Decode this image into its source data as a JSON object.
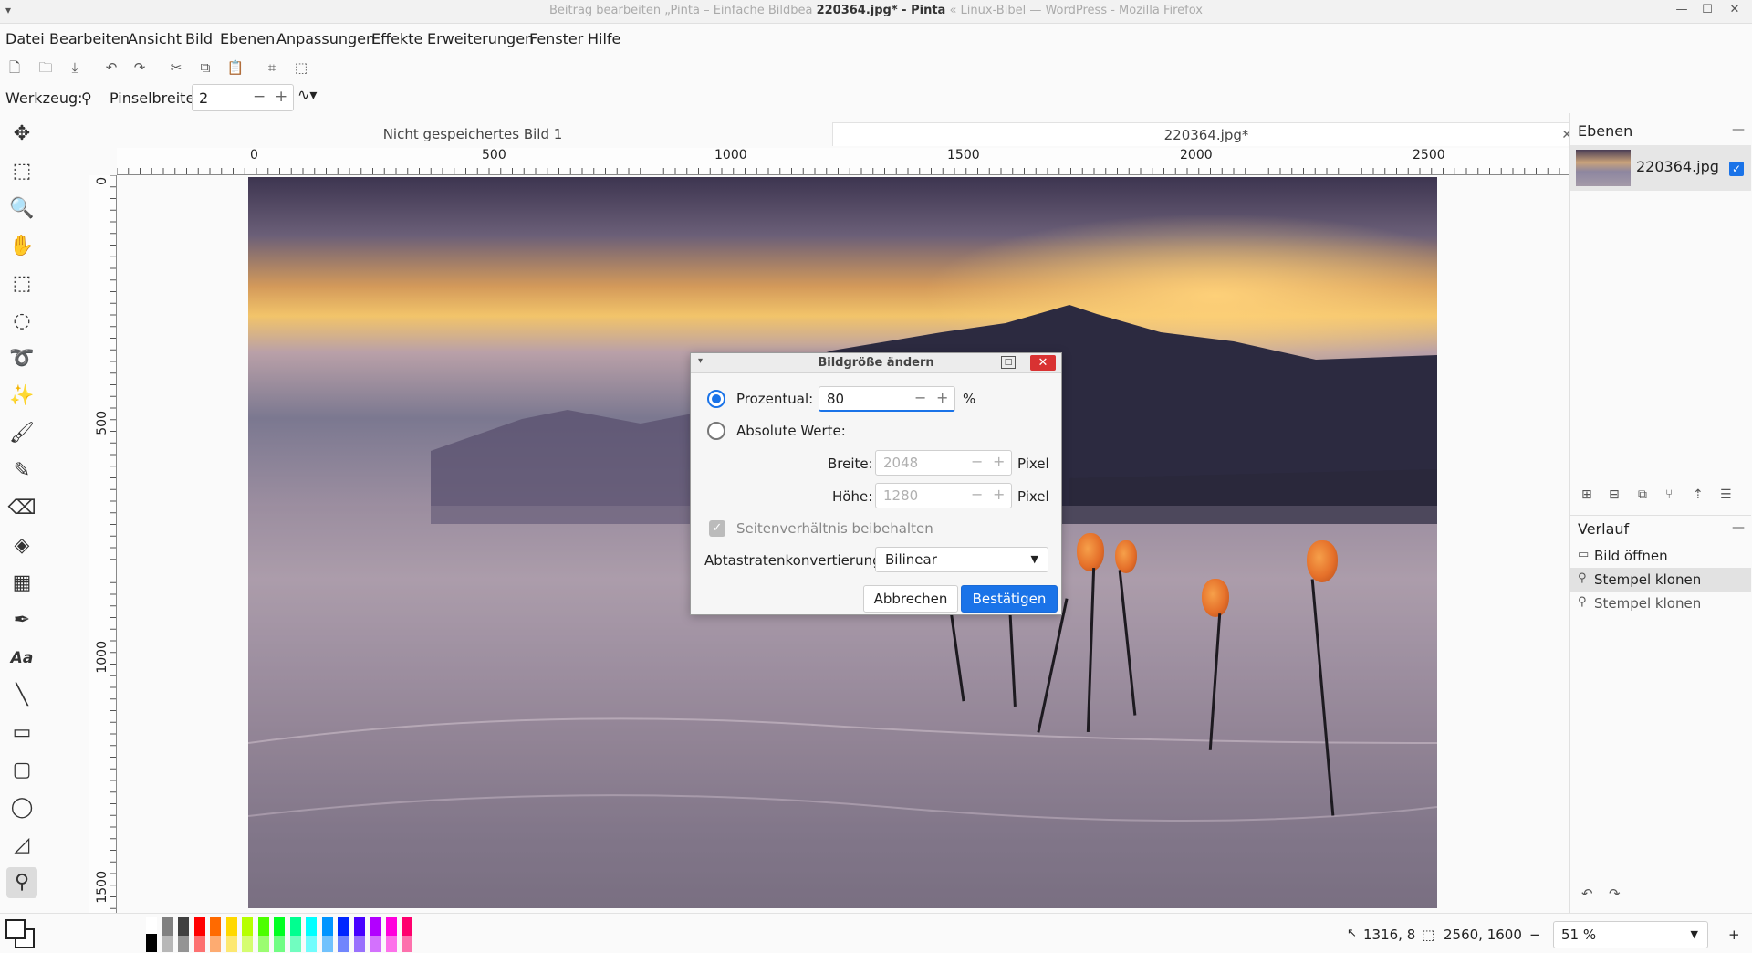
{
  "window": {
    "title_prefix": "Beitrag bearbeiten „Pinta – Einfache Bildbea",
    "title_main": "220364.jpg* - Pinta",
    "title_suffix": "« Linux-Bibel — WordPress - Mozilla Firefox",
    "sys_menu": "▾",
    "minimize": "—",
    "maximize": "☐",
    "close": "✕"
  },
  "menubar": [
    "Datei",
    "Bearbeiten",
    "Ansicht",
    "Bild",
    "Ebenen",
    "Anpassungen",
    "Effekte",
    "Erweiterungen",
    "Fenster",
    "Hilfe"
  ],
  "toolbar_icons": [
    "new-icon",
    "open-icon",
    "save-icon",
    "undo-icon",
    "redo-icon",
    "cut-icon",
    "copy-icon",
    "paste-icon",
    "crop-icon",
    "deselect-icon"
  ],
  "tool_options": {
    "tool_label": "Werkzeug:",
    "brush_label": "Pinselbreite:",
    "brush_value": "2",
    "minus": "−",
    "plus": "+",
    "antialias": "∿▾"
  },
  "tools": [
    {
      "name": "move-selected-tool",
      "glyph": "✥"
    },
    {
      "name": "move-selection-tool",
      "glyph": "⬚"
    },
    {
      "name": "zoom-tool",
      "glyph": "🔍"
    },
    {
      "name": "pan-tool",
      "glyph": "✋"
    },
    {
      "name": "rectangle-select-tool",
      "glyph": "⬚"
    },
    {
      "name": "ellipse-select-tool",
      "glyph": "◌"
    },
    {
      "name": "lasso-select-tool",
      "glyph": "➰"
    },
    {
      "name": "magic-wand-tool",
      "glyph": "✨"
    },
    {
      "name": "paintbrush-tool",
      "glyph": "🖌"
    },
    {
      "name": "pencil-tool",
      "glyph": "✎"
    },
    {
      "name": "eraser-tool",
      "glyph": "⌫"
    },
    {
      "name": "paint-bucket-tool",
      "glyph": "◈"
    },
    {
      "name": "gradient-tool",
      "glyph": "▦"
    },
    {
      "name": "color-picker-tool",
      "glyph": "✒"
    },
    {
      "name": "text-tool",
      "glyph": "Aa"
    },
    {
      "name": "line-tool",
      "glyph": "╲"
    },
    {
      "name": "rectangle-tool",
      "glyph": "▭"
    },
    {
      "name": "rounded-rectangle-tool",
      "glyph": "▢"
    },
    {
      "name": "ellipse-tool",
      "glyph": "◯"
    },
    {
      "name": "freeform-shape-tool",
      "glyph": "◿"
    },
    {
      "name": "clone-stamp-tool",
      "glyph": "⚲"
    }
  ],
  "doc_tabs": [
    {
      "label": "Nicht gespeichertes Bild 1",
      "active": false
    },
    {
      "label": "220364.jpg*",
      "active": true,
      "close": "✕"
    }
  ],
  "rulers": {
    "horizontal": [
      "0",
      "500",
      "1000",
      "1500",
      "2000",
      "2500"
    ],
    "vertical": [
      "0",
      "500",
      "1000",
      "1500"
    ]
  },
  "dialog": {
    "title": "Bildgröße ändern",
    "percent_label": "Prozentual:",
    "percent_value": "80",
    "percent_unit": "%",
    "absolute_label": "Absolute Werte:",
    "width_label": "Breite:",
    "width_value": "2048",
    "height_label": "Höhe:",
    "height_value": "1280",
    "pixel_unit": "Pixel",
    "aspect_label": "Seitenverhältnis beibehalten",
    "resampling_label": "Abtastratenkonvertierung:",
    "resampling_value": "Bilinear",
    "cancel": "Abbrechen",
    "confirm": "Bestätigen",
    "minus": "−",
    "plus": "+"
  },
  "layers_panel": {
    "title": "Ebenen",
    "minimize": "—",
    "layer_name": "220364.jpg",
    "visible_check": "✓"
  },
  "history_panel": {
    "title": "Verlauf",
    "minimize": "—",
    "items": [
      {
        "label": "Bild öffnen",
        "icon": "folder-icon",
        "glyph": "▭",
        "selected": false
      },
      {
        "label": "Stempel klonen",
        "icon": "stamp-icon",
        "glyph": "⚲",
        "selected": true
      },
      {
        "label": "Stempel klonen",
        "icon": "stamp-icon",
        "glyph": "⚲",
        "selected": false
      }
    ],
    "undo": "↶",
    "redo": "↷"
  },
  "statusbar": {
    "cursor_pos": "1316, 8",
    "selection_size": "2560, 1600",
    "zoom_value": "51 %",
    "zoom_out": "−",
    "zoom_in": "+"
  },
  "palette_colors": [
    "#ffffff",
    "#808080",
    "#404040",
    "#ff0000",
    "#ff6a00",
    "#ffd800",
    "#b6ff00",
    "#4cff00",
    "#00ff21",
    "#00ff90",
    "#00ffff",
    "#0094ff",
    "#0026ff",
    "#4800ff",
    "#b200ff",
    "#ff00dc",
    "#ff006e"
  ],
  "accent_color": "#1a73e8"
}
